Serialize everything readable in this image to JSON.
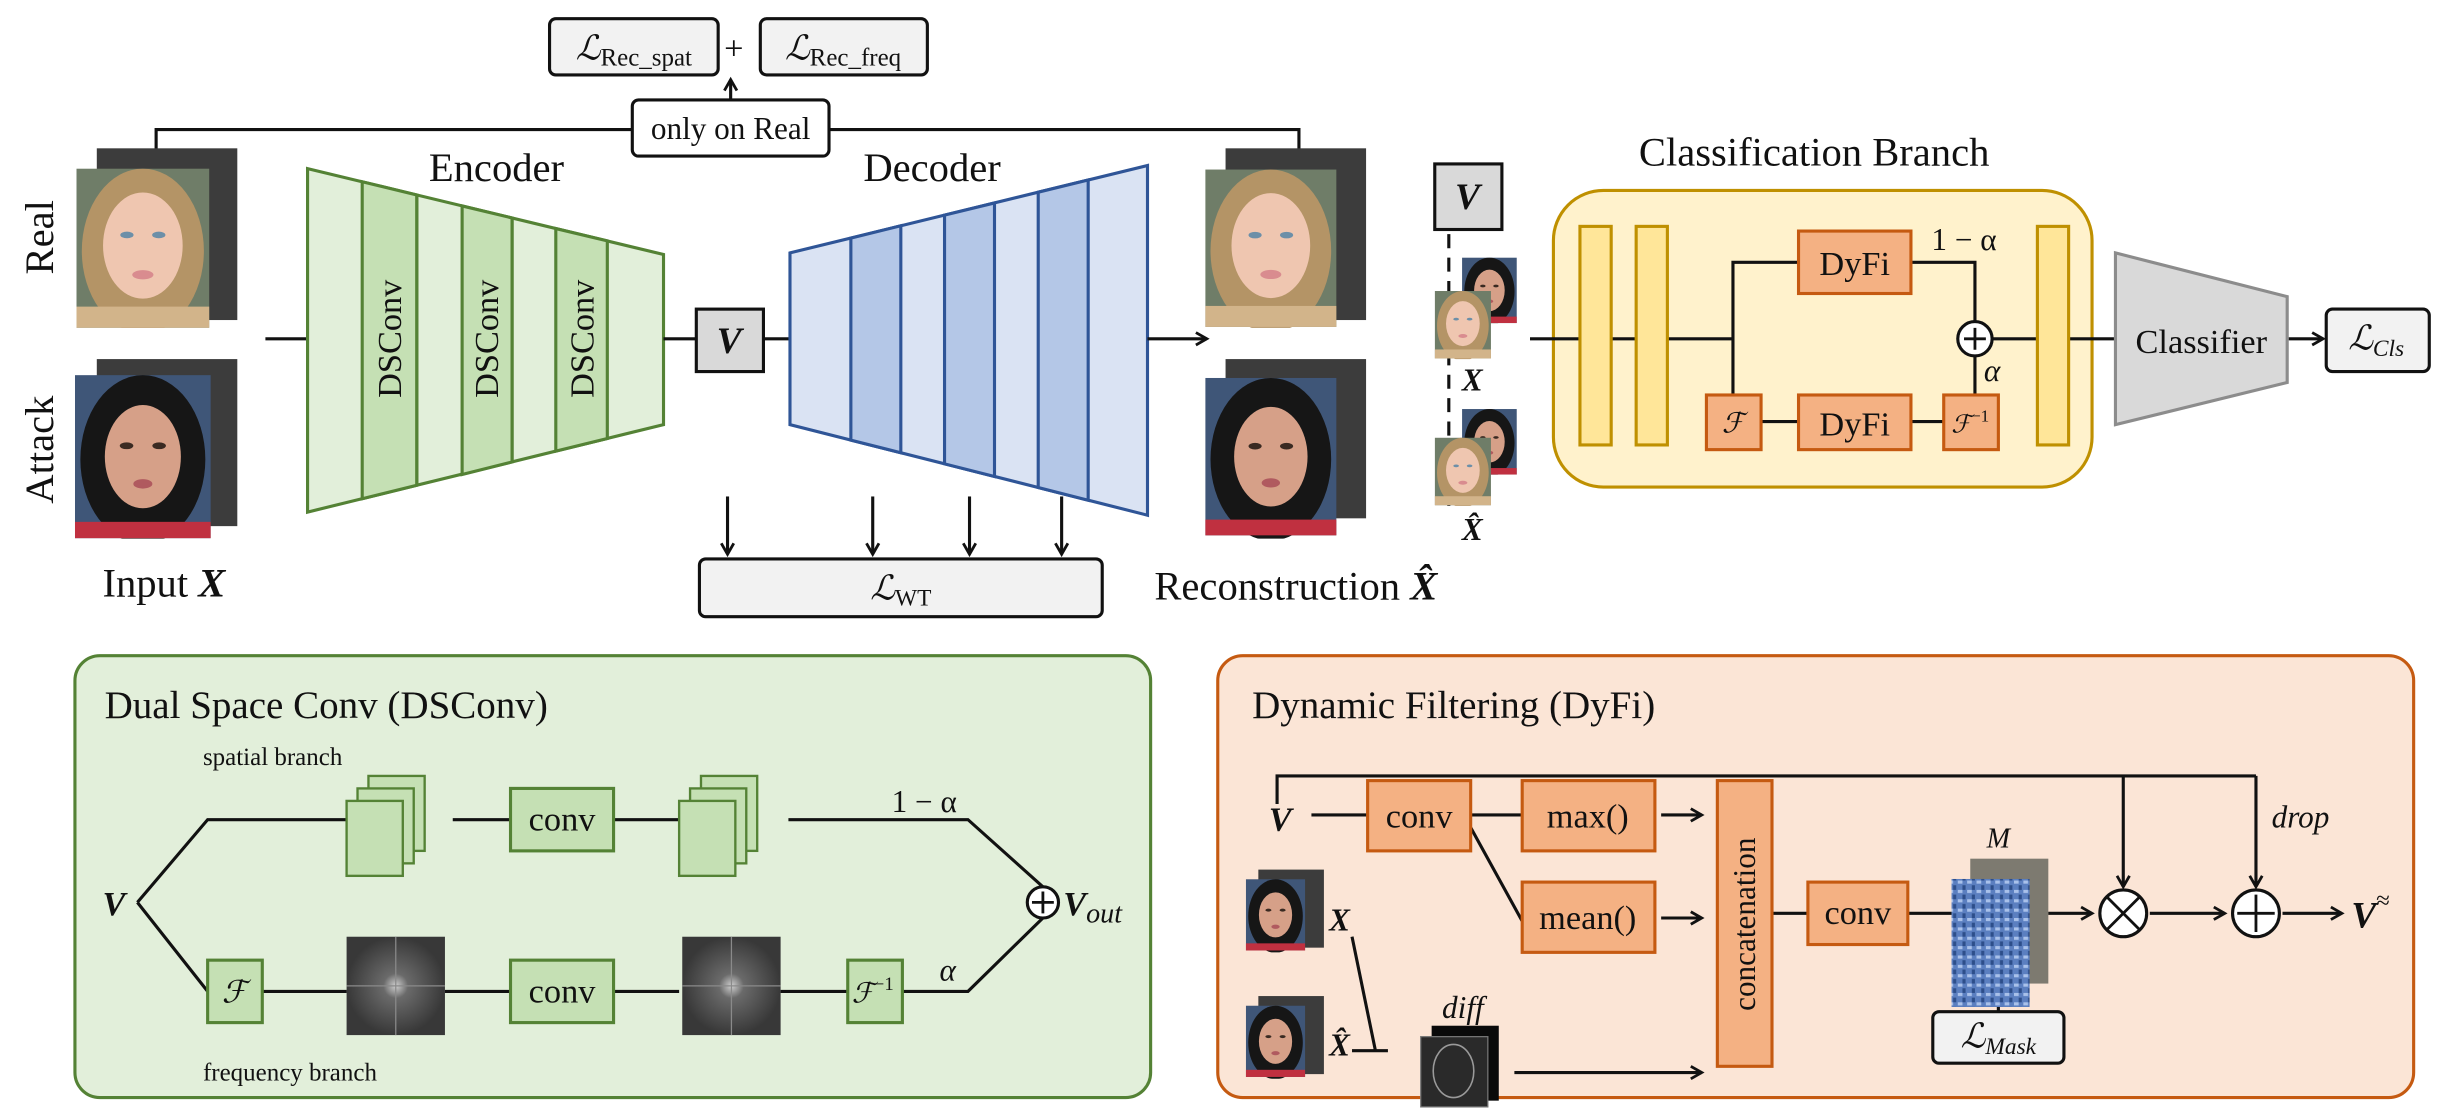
{
  "top": {
    "loss_rec_spat": {
      "symbol": "ℒ",
      "sub": "Rec_spat"
    },
    "plus": "+",
    "loss_rec_freq": {
      "symbol": "ℒ",
      "sub": "Rec_freq"
    },
    "only_on_real": "only on Real",
    "row_real": "Real",
    "row_attack": "Attack",
    "input_label": "Input ",
    "input_var": "X",
    "encoder_title": "Encoder",
    "encoder_blocks": [
      "DSConv",
      "DSConv",
      "DSConv"
    ],
    "latent": "V",
    "decoder_title": "Decoder",
    "loss_wt": {
      "symbol": "ℒ",
      "sub": "WT"
    },
    "reconstruction_label": "Reconstruction ",
    "reconstruction_var": "X̂",
    "cls_latent": "V",
    "cls_input_x": "X",
    "cls_input_xhat": "X̂"
  },
  "classification_branch": {
    "title": "Classification Branch",
    "dyfi_top": "DyFi",
    "dyfi_bottom": "DyFi",
    "fourier": "ℱ",
    "inverse_fourier": "ℱ",
    "inverse_sup": "−1",
    "one_minus_alpha": "1 − α",
    "alpha": "α",
    "classifier": "Classifier",
    "loss_cls": {
      "symbol": "ℒ",
      "sub": "Cls"
    }
  },
  "dsconv_panel": {
    "title": "Dual Space Conv (DSConv)",
    "spatial_branch": "spatial branch",
    "frequency_branch": "frequency branch",
    "input": "V",
    "conv_top": "conv",
    "conv_bottom": "conv",
    "fourier": "ℱ",
    "inverse_fourier": "ℱ",
    "inverse_sup": "−1",
    "one_minus_alpha": "1 − α",
    "alpha": "α",
    "output": "V",
    "output_sub": "out"
  },
  "dyfi_panel": {
    "title": "Dynamic Filtering (DyFi)",
    "input": "V",
    "conv_first": "conv",
    "max": "max()",
    "mean": "mean()",
    "concatenation": "concatenation",
    "conv_second": "conv",
    "mask_label": "M",
    "drop": "drop",
    "x": "X",
    "xhat": "X̂",
    "diff": "diff",
    "loss_mask": {
      "symbol": "ℒ",
      "sub": "Mask"
    },
    "output": "V",
    "output_sup": "≈"
  },
  "colors": {
    "encoder_fill_light": "#e2efda",
    "encoder_fill_dark": "#c5e0b4",
    "encoder_stroke": "#548235",
    "decoder_fill_light": "#dae3f3",
    "decoder_fill_dark": "#b4c7e7",
    "decoder_stroke": "#2f5597",
    "cls_branch_fill": "#fff2cc",
    "cls_branch_stroke": "#bf9000",
    "orange_block": "#f4b183",
    "orange_stroke": "#c55a11",
    "dyfi_panel_fill": "#fbe5d6",
    "classifier_fill": "#d9d9d9"
  }
}
